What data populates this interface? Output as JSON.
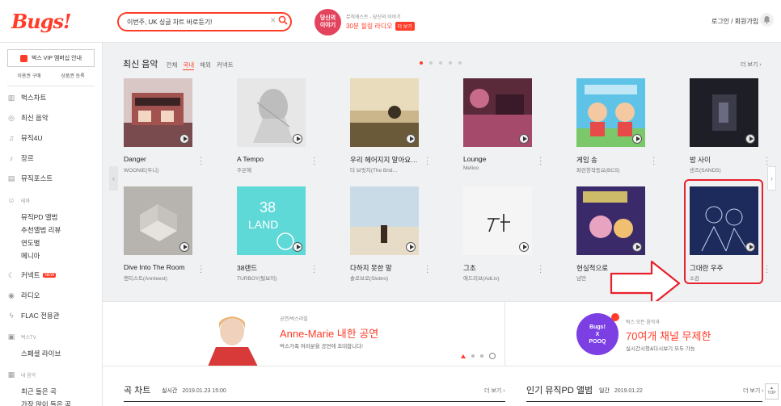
{
  "header": {
    "logo": "Bugs!",
    "search": {
      "value": "이번주, UK 싱글 차트 바로듣기!"
    },
    "promo": {
      "badge": "당신의\n이야기",
      "small": "뮤직캐스트 - 당신의 이야기",
      "main": "30분 힐링 라디오",
      "tag": "더 보기"
    },
    "login": "로그인 / 회원가입"
  },
  "sidebar": {
    "vip": "벅스 VIP 멤버십 안내",
    "buy": "이용권 구매",
    "register": "상품권 등록",
    "items": [
      {
        "label": "벅스차트",
        "icon": "chart-icon"
      },
      {
        "label": "최신 음악",
        "icon": "music-icon"
      },
      {
        "label": "뮤직4U",
        "icon": "note-icon"
      },
      {
        "label": "장르",
        "icon": "guitar-icon"
      },
      {
        "label": "뮤직포스트",
        "icon": "post-icon"
      }
    ],
    "group_theme": "테마",
    "theme_items": [
      "뮤직PD 앨범",
      "추천앨범 리뷰",
      "연도별",
      "메니아"
    ],
    "connect": "커넥트",
    "connect_tag": "NEW",
    "radio": "라디오",
    "flac": "FLAC 전용관",
    "group_tv": "벅스TV",
    "special_live": "스페셜 라이브",
    "group_my": "내 음악",
    "recent": "최근 들은 곡",
    "most": "가장 많이 들은 곡"
  },
  "latest": {
    "title": "최신 음악",
    "tabs": [
      "전체",
      "국내",
      "해외",
      "커넥트"
    ],
    "active_tab": 1,
    "more": "더 보기 ›"
  },
  "albums": [
    {
      "title": "Danger",
      "artist": "WOONIE(우니)"
    },
    {
      "title": "A Tempo",
      "artist": "주은혜"
    },
    {
      "title": "우리 헤어지지 말아요…",
      "artist": "더 브릿지(The Brid…"
    },
    {
      "title": "Lounge",
      "artist": "Melloo"
    },
    {
      "title": "게임 송",
      "artist": "파란창작동요(BCS)"
    },
    {
      "title": "밤 사이",
      "artist": "샌즈(SANDS)"
    },
    {
      "title": "Dive Into The Room",
      "artist": "앤티스트(Annteest)"
    },
    {
      "title": "38랜드",
      "artist": "TURBOY(털보이)"
    },
    {
      "title": "다하지 못한 말",
      "artist": "솔로브로(Slobro)"
    },
    {
      "title": "그초",
      "artist": "애드리브(AdLiv)"
    },
    {
      "title": "현실적으로",
      "artist": "냠먼"
    },
    {
      "title": "그대란 우주",
      "artist": "소감"
    }
  ],
  "banner": {
    "am_small": "공연/벅스라빌",
    "am_title": "Anne-Marie 내한 공연",
    "am_desc": "벅스가족 여러분을 공연에 초대합니다!",
    "pooq_logo_top": "Bugs!",
    "pooq_logo_x": "X",
    "pooq_logo_bottom": "POOQ",
    "pooq_small": "벅스 모든 음악과",
    "pooq_title": "70여개 채널 무제한",
    "pooq_desc": "실시간시청&다시보기 모두 가능"
  },
  "charts": {
    "title": "곡 차트",
    "label": "실시간",
    "date": "2019.01.23 15:00",
    "more": "더 보기 ›"
  },
  "pd": {
    "title": "인기 뮤직PD 앨범",
    "label": "일간",
    "date": "2019.01.22",
    "more": "더 보기 ›"
  },
  "top_button": "TOP",
  "colors": {
    "brand": "#ff3c28",
    "highlight": "#e8212e",
    "main_bg": "#f0f1f2"
  }
}
